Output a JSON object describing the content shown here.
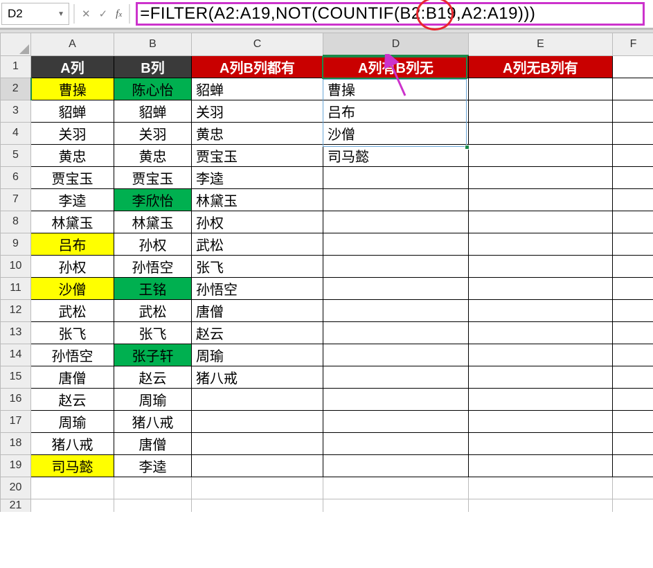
{
  "name_box": "D2",
  "formula": "=FILTER(A2:A19,NOT(COUNTIF(B2:B19,A2:A19)))",
  "col_labels": [
    "A",
    "B",
    "C",
    "D",
    "E",
    "F"
  ],
  "row_labels": [
    "1",
    "2",
    "3",
    "4",
    "5",
    "6",
    "7",
    "8",
    "9",
    "10",
    "11",
    "12",
    "13",
    "14",
    "15",
    "16",
    "17",
    "18",
    "19",
    "20",
    "21"
  ],
  "headers": {
    "A": "A列",
    "B": "B列",
    "C": "A列B列都有",
    "D": "A列有B列无",
    "E": "A列无B列有"
  },
  "colA_highlight_rows": [
    2,
    9,
    11,
    19
  ],
  "colB_highlight_rows": [
    2,
    7,
    11,
    14
  ],
  "rows": [
    {
      "A": "曹操",
      "B": "陈心怡",
      "C": "貂蝉",
      "D": "曹操",
      "E": ""
    },
    {
      "A": "貂蝉",
      "B": "貂蝉",
      "C": "关羽",
      "D": "吕布",
      "E": ""
    },
    {
      "A": "关羽",
      "B": "关羽",
      "C": "黄忠",
      "D": "沙僧",
      "E": ""
    },
    {
      "A": "黄忠",
      "B": "黄忠",
      "C": "贾宝玉",
      "D": "司马懿",
      "E": ""
    },
    {
      "A": "贾宝玉",
      "B": "贾宝玉",
      "C": "李逵",
      "D": "",
      "E": ""
    },
    {
      "A": "李逵",
      "B": "李欣怡",
      "C": "林黛玉",
      "D": "",
      "E": ""
    },
    {
      "A": "林黛玉",
      "B": "林黛玉",
      "C": "孙权",
      "D": "",
      "E": ""
    },
    {
      "A": "吕布",
      "B": "孙权",
      "C": "武松",
      "D": "",
      "E": ""
    },
    {
      "A": "孙权",
      "B": "孙悟空",
      "C": "张飞",
      "D": "",
      "E": ""
    },
    {
      "A": "沙僧",
      "B": "王铭",
      "C": "孙悟空",
      "D": "",
      "E": ""
    },
    {
      "A": "武松",
      "B": "武松",
      "C": "唐僧",
      "D": "",
      "E": ""
    },
    {
      "A": "张飞",
      "B": "张飞",
      "C": "赵云",
      "D": "",
      "E": ""
    },
    {
      "A": "孙悟空",
      "B": "张子轩",
      "C": "周瑜",
      "D": "",
      "E": ""
    },
    {
      "A": "唐僧",
      "B": "赵云",
      "C": "猪八戒",
      "D": "",
      "E": ""
    },
    {
      "A": "赵云",
      "B": "周瑜",
      "C": "",
      "D": "",
      "E": ""
    },
    {
      "A": "周瑜",
      "B": "猪八戒",
      "C": "",
      "D": "",
      "E": ""
    },
    {
      "A": "猪八戒",
      "B": "唐僧",
      "C": "",
      "D": "",
      "E": ""
    },
    {
      "A": "司马懿",
      "B": "李逵",
      "C": "",
      "D": "",
      "E": ""
    }
  ]
}
